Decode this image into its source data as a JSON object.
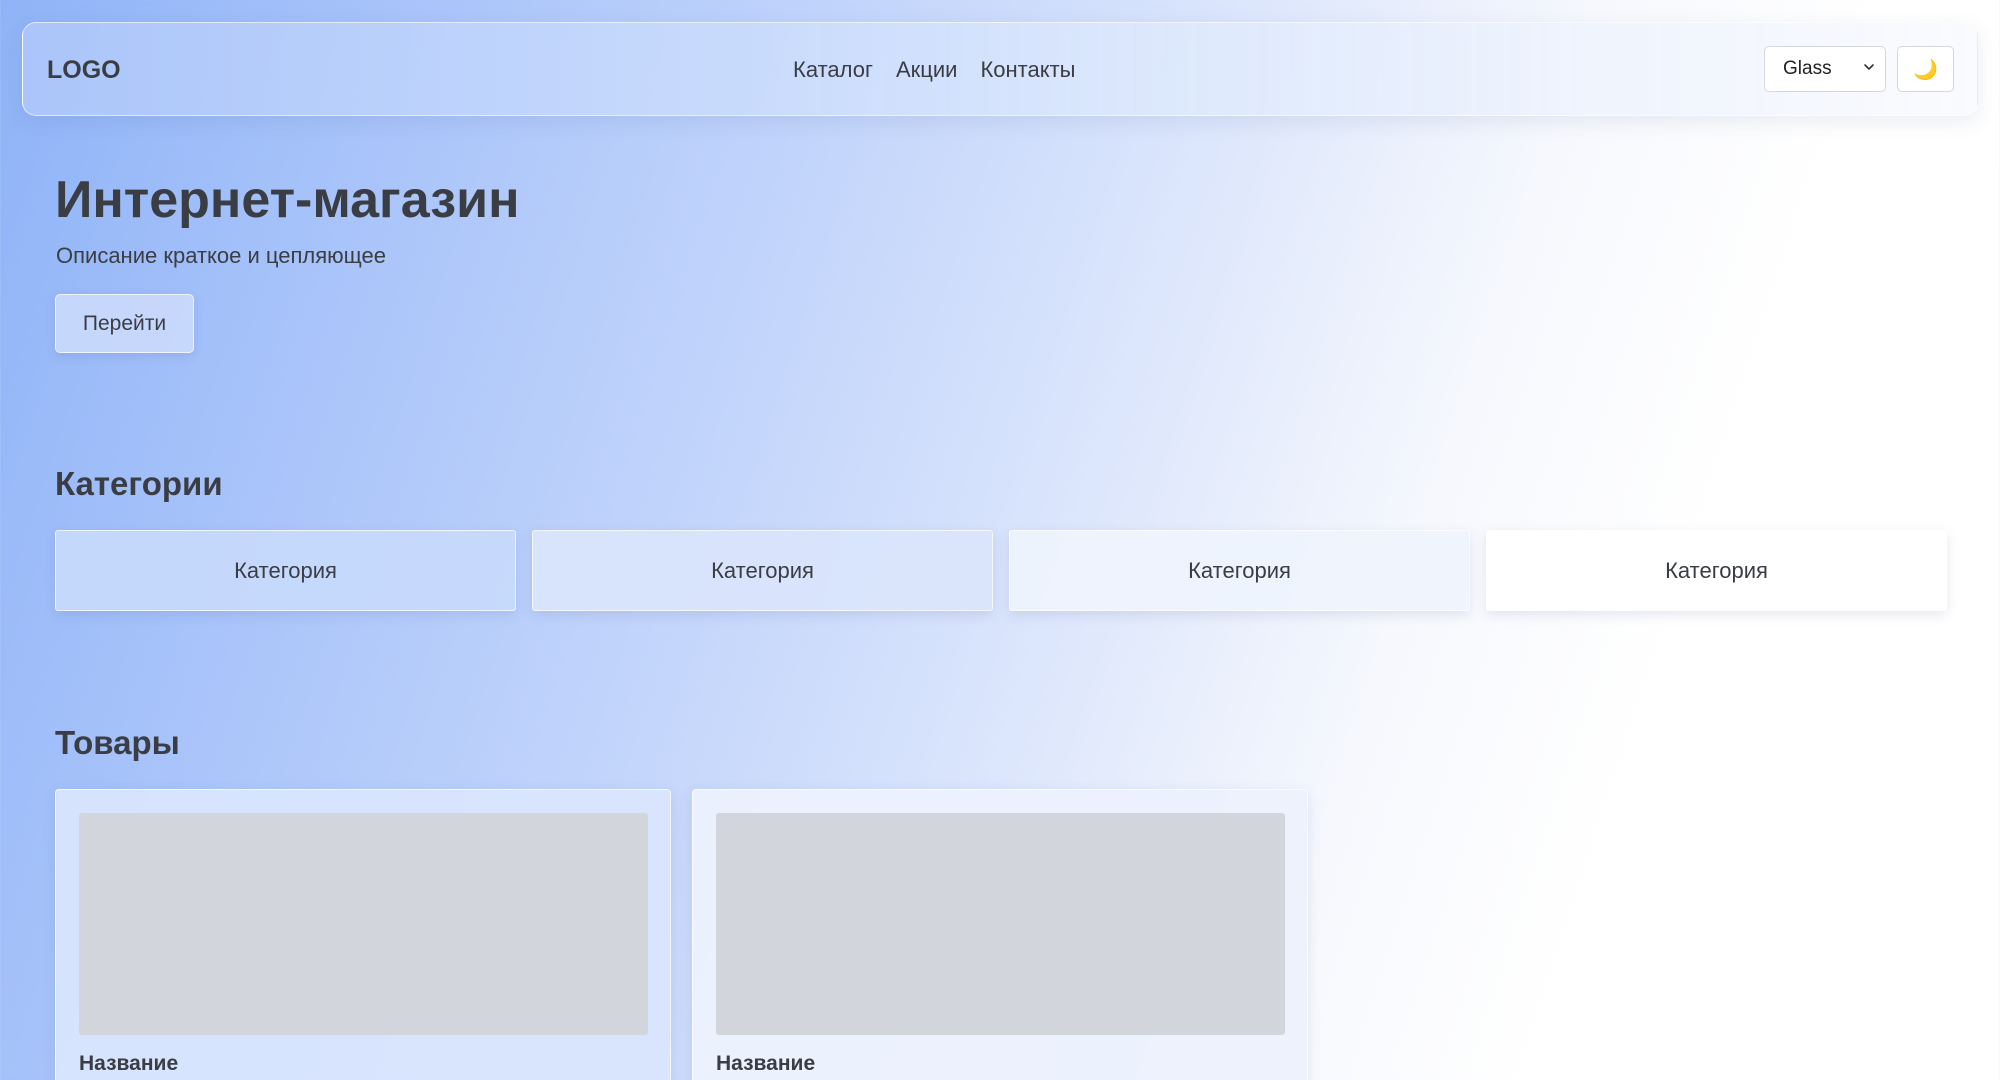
{
  "header": {
    "logo": "LOGO",
    "nav": [
      "Каталог",
      "Акции",
      "Контакты"
    ],
    "theme_select": {
      "selected": "Glass"
    },
    "mode_icon": "🌙"
  },
  "hero": {
    "title": "Интернет-магазин",
    "subtitle": "Описание краткое и цепляющее",
    "button": "Перейти"
  },
  "categories": {
    "title": "Категории",
    "items": [
      "Категория",
      "Категория",
      "Категория",
      "Категория"
    ]
  },
  "products": {
    "title": "Товары",
    "items": [
      {
        "name": "Название"
      },
      {
        "name": "Название"
      }
    ]
  },
  "colors": {
    "text": "#3a3d44",
    "accent_blue": "#8fb3f7",
    "placeholder": "#d2d5dc"
  }
}
